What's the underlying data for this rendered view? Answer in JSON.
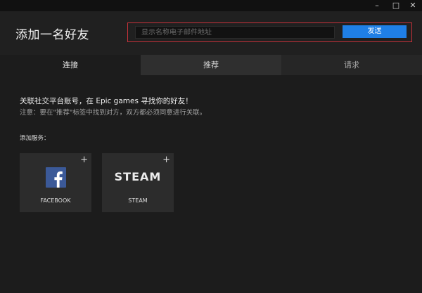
{
  "window": {
    "minimize_glyph": "–",
    "maximize_glyph": "□",
    "close_glyph": "✕"
  },
  "header": {
    "title": "添加一名好友",
    "search_placeholder": "显示名称电子邮件地址",
    "send_label": "发送"
  },
  "tabs": [
    {
      "label": "连接",
      "active": true
    },
    {
      "label": "推荐",
      "active": false
    },
    {
      "label": "请求",
      "active": false
    }
  ],
  "content": {
    "intro": "关联社交平台账号，在 Epic games 寻找你的好友！",
    "note": "注意：要在\"推荐\"标签中找到对方，双方都必须同意进行关联。",
    "services_label": "添加服务："
  },
  "services": [
    {
      "label": "FACEBOOK",
      "icon": "facebook-icon"
    },
    {
      "label": "STEAM",
      "logo_text": "STEAM",
      "icon": "steam-logo"
    }
  ],
  "colors": {
    "accent": "#1f7fe6",
    "highlight_border": "#c8323a",
    "facebook_blue": "#3b5998"
  }
}
